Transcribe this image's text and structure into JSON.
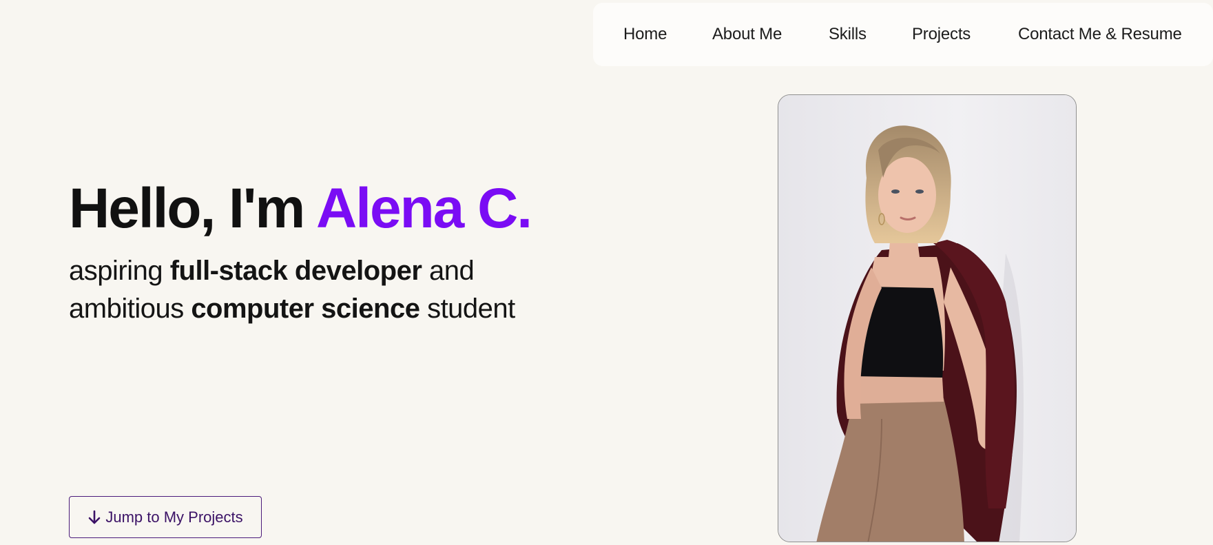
{
  "nav": {
    "items": [
      {
        "label": "Home"
      },
      {
        "label": "About Me"
      },
      {
        "label": "Skills"
      },
      {
        "label": "Projects"
      },
      {
        "label": "Contact Me & Resume"
      }
    ]
  },
  "hero": {
    "greeting": "Hello, I'm ",
    "name": "Alena C.",
    "line1_prefix": "aspiring ",
    "line1_bold": "full-stack developer",
    "line1_suffix": " and",
    "line2_prefix": "ambitious ",
    "line2_bold": "computer science",
    "line2_suffix": " student"
  },
  "cta": {
    "label": "Jump to My Projects",
    "icon": "arrow-down-icon"
  },
  "portrait": {
    "description_icon": "portrait-photo"
  },
  "colors": {
    "background": "#f8f6f1",
    "accent": "#7a0cf4",
    "button_border": "#4a1a7a"
  }
}
